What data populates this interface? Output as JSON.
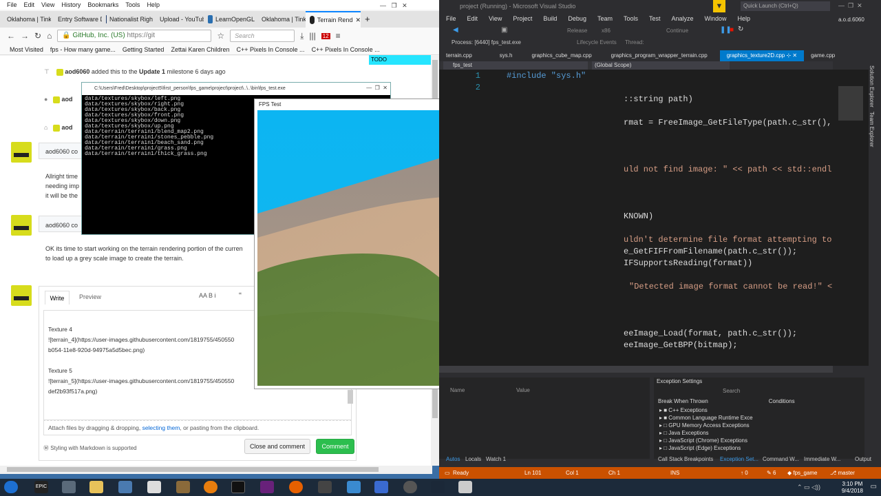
{
  "firefox": {
    "menu": [
      "File",
      "Edit",
      "View",
      "History",
      "Bookmarks",
      "Tools",
      "Help"
    ],
    "tabs": [
      "Oklahoma | Tink",
      "Entry Software D",
      "Nationalist Righ",
      "Upload - YouTub",
      "LearnOpenGL",
      "Oklahoma | Tink",
      "Terrain Rend"
    ],
    "url_site": "GitHub, Inc. (US)",
    "url_text": "https://git",
    "search_placeholder": "Search",
    "badge": "12",
    "bookmarks": [
      "Most Visited",
      "fps - How many game...",
      "Getting Started",
      "Zettai Karen Children",
      "C++ Pixels In Console ...",
      "C++ Pixels In Console ..."
    ],
    "todo": "TODO"
  },
  "github": {
    "milestone_user": "aod6060",
    "milestone_text": "added this to the",
    "milestone_name": "Update 1",
    "milestone_time": "milestone 6 days ago",
    "row2_user": "aod",
    "row3_user": "aod",
    "comment1_user": "aod6060 co",
    "comment1_lines": [
      "Allright time",
      "needing imp",
      "it will be the"
    ],
    "comment2_user": "aod6060 co",
    "comment2_lines": [
      "OK its time to start working on the terrain rendering portion of the curren",
      "to load up a grey scale image to create the terrain."
    ],
    "tab_write": "Write",
    "tab_preview": "Preview",
    "toolbar": "AA B i",
    "quote": "“",
    "body_lines": [
      "Texture 4",
      "![terrain_4](https://user-images.githubusercontent.com/1819755/450550",
      "b054-11e8-920d-94975a5d5bec.png)",
      "",
      "Texture 5",
      "![terrain_5](https://user-images.githubusercontent.com/1819755/450550",
      "def2b93f517a.png)"
    ],
    "attach_prefix": "Attach files by dragging & dropping, ",
    "attach_link": "selecting them",
    "attach_suffix": ", or pasting from the clipboard.",
    "markdown_note": "Styling with Markdown is supported",
    "close_comment": "Close and comment",
    "comment_btn": "Comment"
  },
  "console": {
    "title": "C:\\Users\\Fred\\Desktop\\project5\\first_person\\fps_game\\project\\project\\..\\..\\bin\\fps_test.exe",
    "lines": [
      "data/textures/skybox/left.png",
      "data/textures/skybox/right.png",
      "data/textures/skybox/back.png",
      "data/textures/skybox/front.png",
      "data/textures/skybox/down.png",
      "data/textures/skybox/up.png",
      "data/terrain/terrain1/blend_map2.png",
      "data/terrain/terrain1/stones_pebble.png",
      "data/terrain/terrain1/beach_sand.png",
      "data/terrain/terrain1/grass.png",
      "data/terrain/terrain1/thick_grass.png"
    ]
  },
  "fps": {
    "title": "FPS Test",
    "close": "✕"
  },
  "vs": {
    "title": "project (Running) - Microsoft Visual Studio",
    "quick_launch": "Quick Launch (Ctrl+Q)",
    "user": "a.o.d.6060",
    "menu": [
      "File",
      "Edit",
      "View",
      "Project",
      "Build",
      "Debug",
      "Team",
      "Tools",
      "Test",
      "Analyze",
      "Window",
      "Help"
    ],
    "release": "Release",
    "platform": "x86",
    "continue": "Continue",
    "process": "Process:  [6440] fps_test.exe",
    "lifecycle": "Lifecycle Events",
    "thread": "Thread:",
    "tabs": [
      "terrain.cpp",
      "sys.h",
      "graphics_cube_map.cpp",
      "graphics_program_wrapper_terrain.cpp",
      "graphics_texture2D.cpp",
      "game.cpp"
    ],
    "scope_left": "fps_test",
    "scope_right": "(Global Scope)",
    "line_numbers": [
      "1",
      "2"
    ],
    "code_include": "#include \"sys.h\"",
    "code_fragments": [
      "::string path)",
      "rmat = FreeImage_GetFileType(path.c_str(),",
      "uld not find image: \" << path << std::endl",
      "KNOWN)",
      "uldn't determine file format attempting to",
      "e_GetFIFFromFilename(path.c_str());",
      "IFSupportsReading(format))",
      "\"Detected image format cannot be read!\" <",
      "eeImage_Load(format, path.c_str());",
      "eeImage_GetBPP(bitmap);"
    ],
    "locals_headers": [
      "Name",
      "Value"
    ],
    "exc_title": "Exception Settings",
    "exc_search": "Search",
    "exc_headers": [
      "Break When Thrown",
      "Conditions"
    ],
    "exc_rows": [
      "C++ Exceptions",
      "Common Language Runtime Exce",
      "GPU Memory Access Exceptions",
      "Java Exceptions",
      "JavaScript (Chrome) Exceptions",
      "JavaScript (Edge) Exceptions"
    ],
    "bottom_tabs_left": [
      "Autos",
      "Locals",
      "Watch 1"
    ],
    "bottom_tabs_right": [
      "Call Stack",
      "Breakpoints",
      "Exception Set...",
      "Command W...",
      "Immediate W...",
      "Output"
    ],
    "status": {
      "ready": "Ready",
      "ln": "Ln 101",
      "col": "Col 1",
      "ch": "Ch 1",
      "ins": "INS",
      "up": "0",
      "edits": "6",
      "repo": "fps_game",
      "branch": "master"
    },
    "side_labels": [
      "Solution Explorer",
      "Team Explorer"
    ]
  },
  "taskbar": {
    "time": "3:10 PM",
    "date": "9/4/2018",
    "epic": "EPIC"
  }
}
